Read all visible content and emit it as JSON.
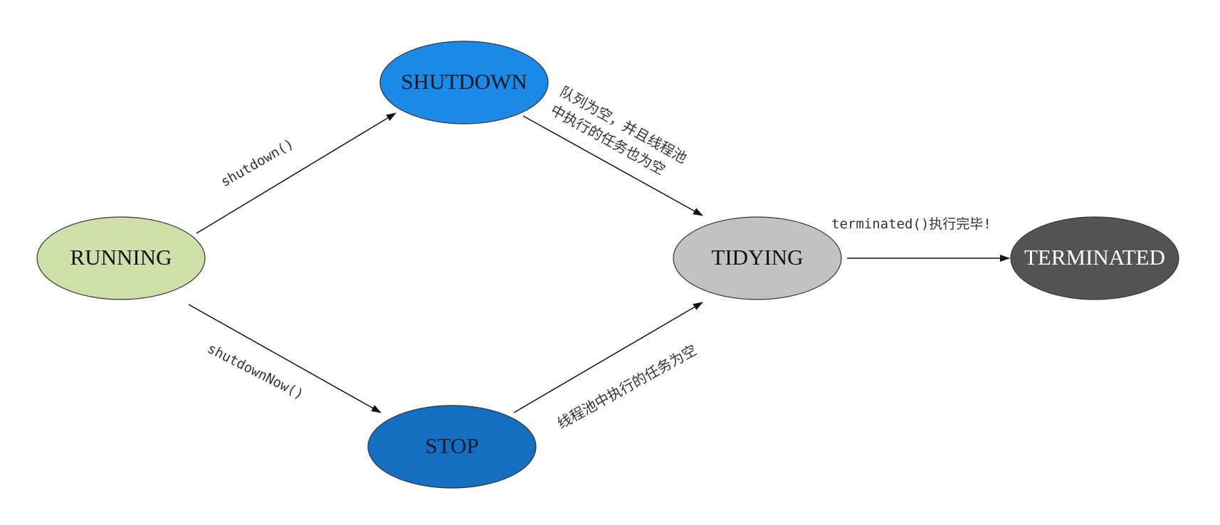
{
  "states": {
    "running": {
      "label": "RUNNING",
      "fill": "#cfdfa9",
      "text_color": "#111111"
    },
    "shutdown": {
      "label": "SHUTDOWN",
      "fill": "#1b8ae6",
      "text_color": "#0d1a2a"
    },
    "stop": {
      "label": "STOP",
      "fill": "#156fc0",
      "text_color": "#0d1a2a"
    },
    "tidying": {
      "label": "TIDYING",
      "fill": "#c2c2c2",
      "text_color": "#111111"
    },
    "terminated": {
      "label": "TERMINATED",
      "fill": "#545454",
      "text_color": "#ffffff"
    }
  },
  "transitions": {
    "running_to_shutdown": {
      "label": "shutdown()"
    },
    "running_to_stop": {
      "label": "shutdownNow()"
    },
    "shutdown_to_tidying": {
      "label_line1": "队列为空，并且线程池",
      "label_line2": "中执行的任务也为空"
    },
    "stop_to_tidying": {
      "label": "线程池中执行的任务为空"
    },
    "tidying_to_terminated": {
      "label": "terminated()执行完毕!"
    }
  }
}
